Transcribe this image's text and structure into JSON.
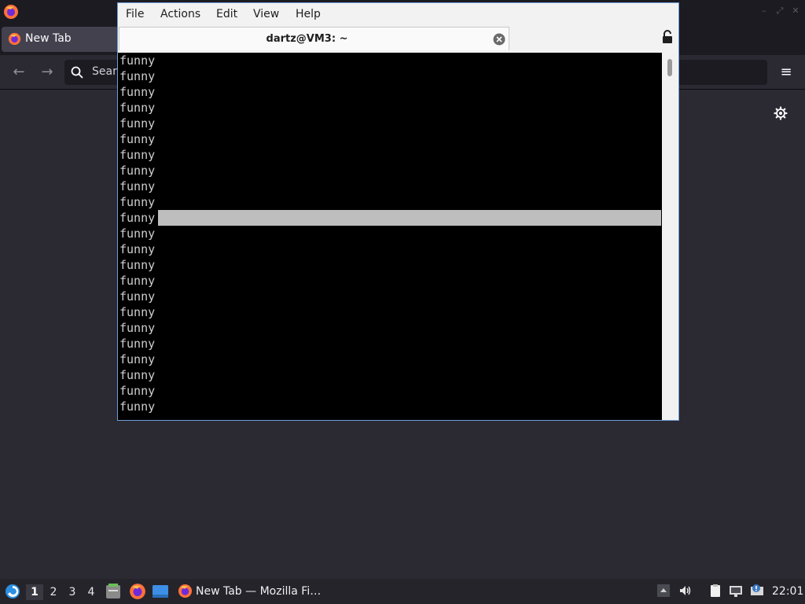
{
  "browser": {
    "tab_label": "New Tab",
    "url_placeholder": "Sear",
    "colors": {
      "chrome": "#1c1b22",
      "page": "#2b2a33"
    }
  },
  "terminal": {
    "menu": [
      "File",
      "Actions",
      "Edit",
      "View",
      "Help"
    ],
    "tab_title": "dartz@VM3: ~",
    "lines": [
      "funny",
      "funny",
      "funny",
      "funny",
      "funny",
      "funny",
      "funny",
      "funny",
      "funny",
      "funny",
      "funny",
      "funny",
      "funny",
      "funny",
      "funny",
      "funny",
      "funny",
      "funny",
      "funny",
      "funny",
      "funny",
      "funny",
      "funny"
    ],
    "cursor_line_index": 10,
    "colors": {
      "background": "#000000",
      "foreground": "#cfcfcf",
      "cursor": "#bebebe"
    }
  },
  "taskbar": {
    "workspaces": [
      "1",
      "2",
      "3",
      "4"
    ],
    "active_workspace": "1",
    "task_label": "New Tab — Mozilla Fi…",
    "clock": "22:01"
  }
}
